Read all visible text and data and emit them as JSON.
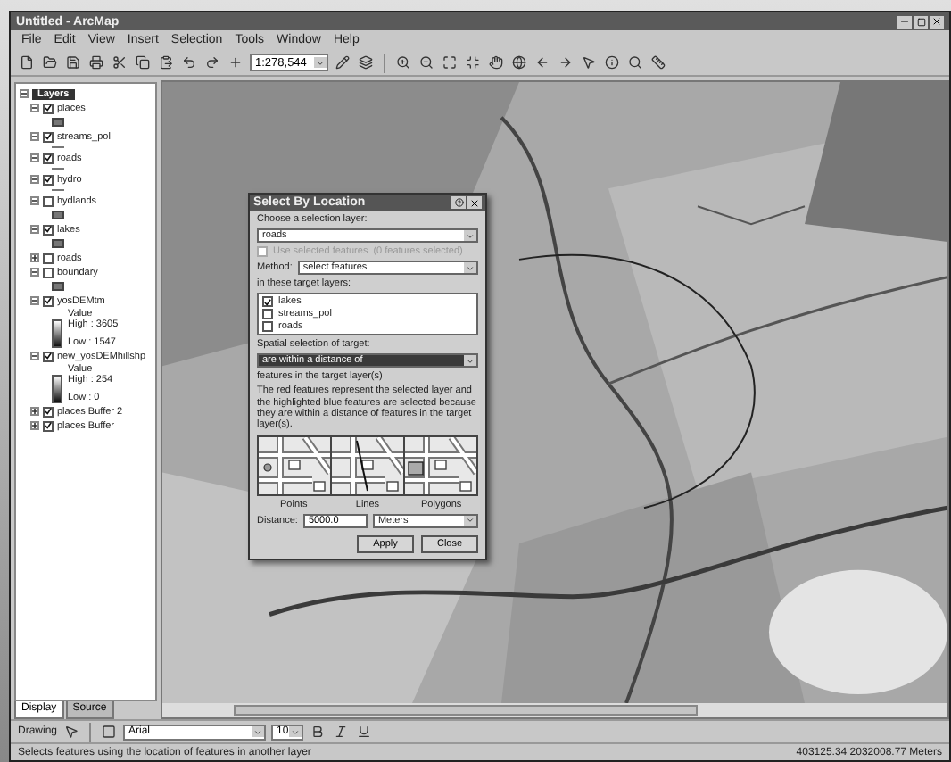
{
  "window": {
    "title": "Untitled - ArcMap"
  },
  "menu": [
    "File",
    "Edit",
    "View",
    "Insert",
    "Selection",
    "Tools",
    "Window",
    "Help"
  ],
  "toolbar": {
    "scale": "1:278,544"
  },
  "toc": {
    "root": "Layers",
    "layers": [
      {
        "name": "places",
        "checked": true,
        "expanded": true,
        "legend": {
          "kind": "swatch"
        }
      },
      {
        "name": "streams_pol",
        "checked": true,
        "expanded": true,
        "legend": {
          "kind": "line"
        }
      },
      {
        "name": "roads",
        "checked": true,
        "expanded": true,
        "legend": {
          "kind": "line"
        }
      },
      {
        "name": "hydro",
        "checked": true,
        "expanded": true,
        "legend": {
          "kind": "line"
        }
      },
      {
        "name": "hydlands",
        "checked": false,
        "expanded": true,
        "legend": {
          "kind": "swatch"
        }
      },
      {
        "name": "lakes",
        "checked": true,
        "expanded": true,
        "legend": {
          "kind": "swatch"
        }
      },
      {
        "name": "roads",
        "checked": false,
        "expanded": false
      },
      {
        "name": "boundary",
        "checked": false,
        "expanded": true,
        "legend": {
          "kind": "swatch"
        }
      },
      {
        "name": "yosDEMtm",
        "checked": true,
        "expanded": true,
        "legend": {
          "kind": "ramp",
          "title": "Value",
          "high": "High : 3605",
          "low": "Low : 1547"
        }
      },
      {
        "name": "new_yosDEMhillshp",
        "checked": true,
        "expanded": true,
        "legend": {
          "kind": "ramp",
          "title": "Value",
          "high": "High : 254",
          "low": "Low : 0"
        }
      },
      {
        "name": "places Buffer 2",
        "checked": true,
        "expanded": false
      },
      {
        "name": "places Buffer",
        "checked": true,
        "expanded": false
      }
    ]
  },
  "toc_tabs": [
    {
      "label": "Display",
      "selected": true
    },
    {
      "label": "Source",
      "selected": false
    }
  ],
  "dialog": {
    "title": "Select By Location",
    "selection_label": "Choose a selection layer:",
    "selection_layer": "roads",
    "use_selected": {
      "label": "Use selected features",
      "note": "(0 features selected)",
      "checked": false,
      "disabled": true
    },
    "method_label": "Method:",
    "method": "select features",
    "targets_label": "in these target layers:",
    "targets": [
      {
        "name": "lakes",
        "checked": true
      },
      {
        "name": "streams_pol",
        "checked": false
      },
      {
        "name": "roads",
        "checked": false
      }
    ],
    "spatial_label": "Spatial selection of target:",
    "spatial": "are within a distance of",
    "target_note": "features in the target layer(s)",
    "description": "The red features represent the selected layer and the highlighted blue features are selected because they are within a distance of features in the target layer(s).",
    "examples": [
      "Points",
      "Lines",
      "Polygons"
    ],
    "distance_label": "Distance:",
    "distance": "5000.0",
    "units": "Meters",
    "buttons": [
      "Apply",
      "Close"
    ]
  },
  "drawing_toolbar": {
    "label": "Drawing",
    "font": "Arial",
    "size": "10"
  },
  "status_bar": {
    "message": "Selects features using the location of features in another layer",
    "coordinates": "403125.34  2032008.77 Meters"
  }
}
